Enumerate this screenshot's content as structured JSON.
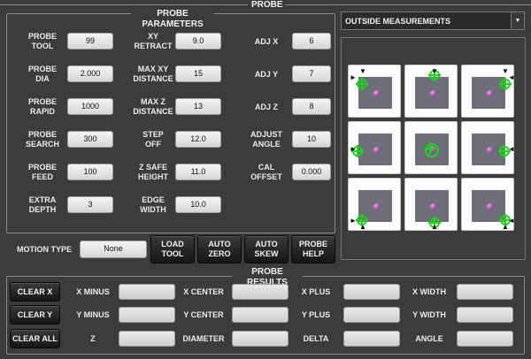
{
  "top_title": "PROBE",
  "params": {
    "title": "PROBE PARAMETERS",
    "rows": [
      [
        {
          "label": "PROBE\nTOOL",
          "value": "99"
        },
        {
          "label": "XY\nRETRACT",
          "value": "9.0"
        },
        {
          "label": "ADJ X",
          "value": "6"
        }
      ],
      [
        {
          "label": "PROBE\nDIA",
          "value": "2.000"
        },
        {
          "label": "MAX XY\nDISTANCE",
          "value": "15"
        },
        {
          "label": "ADJ Y",
          "value": "7"
        }
      ],
      [
        {
          "label": "PROBE\nRAPID",
          "value": "1000"
        },
        {
          "label": "MAX Z\nDISTANCE",
          "value": "13"
        },
        {
          "label": "ADJ Z",
          "value": "8"
        }
      ],
      [
        {
          "label": "PROBE\nSEARCH",
          "value": "300"
        },
        {
          "label": "STEP\nOFF",
          "value": "12.0"
        },
        {
          "label": "ADJUST\nANGLE",
          "value": "10"
        }
      ],
      [
        {
          "label": "PROBE\nFEED",
          "value": "100"
        },
        {
          "label": "Z SAFE\nHEIGHT",
          "value": "11.0"
        },
        {
          "label": "CAL\nOFFSET",
          "value": "0.000"
        }
      ],
      [
        {
          "label": "EXTRA\nDEPTH",
          "value": "3"
        },
        {
          "label": "EDGE\nWIDTH",
          "value": "10.0"
        },
        null
      ]
    ]
  },
  "motion": {
    "label": "MOTION TYPE",
    "value": "None",
    "buttons": [
      "LOAD\nTOOL",
      "AUTO\nZERO",
      "AUTO\nSKEW",
      "PROBE\nHELP"
    ]
  },
  "measurement_mode": {
    "selected": "OUTSIDE MEASUREMENTS"
  },
  "results": {
    "title": "PROBE RESULTS",
    "clear_buttons": [
      "CLEAR X",
      "CLEAR Y",
      "CLEAR ALL"
    ],
    "rows": [
      [
        "X MINUS",
        "X CENTER",
        "X PLUS",
        "X WIDTH"
      ],
      [
        "Y MINUS",
        "Y CENTER",
        "Y PLUS",
        "Y WIDTH"
      ],
      [
        "Z",
        "DIAMETER",
        "DELTA",
        "ANGLE"
      ]
    ]
  },
  "colors": {
    "background": "#3c3c3c",
    "probe_ring": "#1ed21e",
    "probe_ball": "#8a1c8a"
  },
  "icons": {
    "grid_cell": "probe-position-icon",
    "dropdown": "chevron-down-icon"
  }
}
